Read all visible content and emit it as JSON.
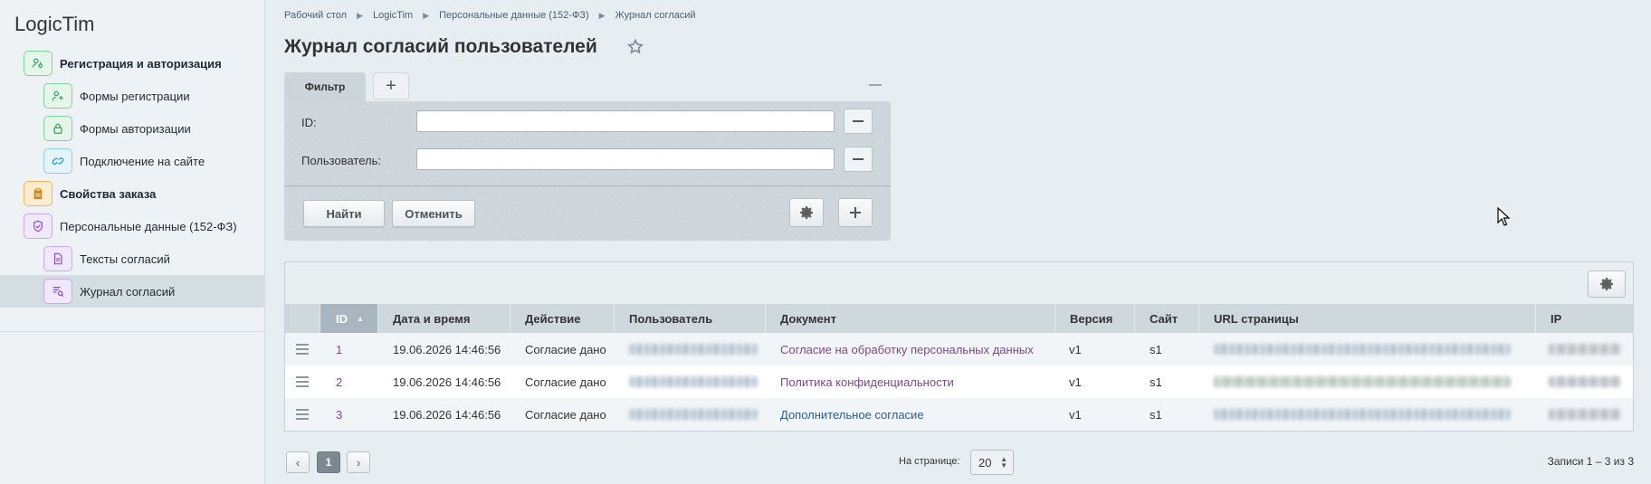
{
  "app": {
    "title": "LogicTim"
  },
  "sidebar": {
    "items": [
      {
        "label": "Регистрация и авторизация",
        "icon": "user-key-icon"
      },
      {
        "label": "Формы регистрации",
        "icon": "user-add-icon"
      },
      {
        "label": "Формы авторизации",
        "icon": "lock-icon"
      },
      {
        "label": "Подключение на сайте",
        "icon": "link-icon"
      },
      {
        "label": "Свойства заказа",
        "icon": "clipboard-icon"
      },
      {
        "label": "Персональные данные (152-ФЗ)",
        "icon": "shield-icon"
      },
      {
        "label": "Тексты согласий",
        "icon": "document-icon"
      },
      {
        "label": "Журнал согласий",
        "icon": "journal-search-icon"
      }
    ],
    "active_item": "Журнал согласий"
  },
  "breadcrumb": [
    "Рабочий стол",
    "LogicTim",
    "Персональные данные (152-ФЗ)",
    "Журнал согласий"
  ],
  "page": {
    "title": "Журнал согласий пользователей"
  },
  "filter": {
    "tab_label": "Фильтр",
    "add_tab_label": "+",
    "fields": [
      {
        "label": "ID:",
        "value": ""
      },
      {
        "label": "Пользователь:",
        "value": ""
      }
    ],
    "find_label": "Найти",
    "cancel_label": "Отменить"
  },
  "grid": {
    "columns": [
      "ID",
      "Дата и время",
      "Действие",
      "Пользователь",
      "Документ",
      "Версия",
      "Сайт",
      "URL страницы",
      "IP"
    ],
    "sorted_column": "ID",
    "sort_direction": "asc",
    "rows": [
      {
        "id": "1",
        "datetime": "19.06.2026 14:46:56",
        "action": "Согласие дано",
        "document": "Согласие на обработку персональных данных",
        "version": "v1",
        "site": "s1"
      },
      {
        "id": "2",
        "datetime": "19.06.2026 14:46:56",
        "action": "Согласие дано",
        "document": "Политика конфиденциальности",
        "version": "v1",
        "site": "s1"
      },
      {
        "id": "3",
        "datetime": "19.06.2026 14:46:56",
        "action": "Согласие дано",
        "document": "Дополнительное согласие",
        "version": "v1",
        "site": "s1"
      }
    ]
  },
  "pager": {
    "prev_label": "‹",
    "current_page": "1",
    "next_label": "›",
    "per_page_label": "На странице:",
    "per_page_value": "20",
    "records_label": "Записи 1 – 3 из 3"
  },
  "colors": {
    "link_purple": "#7a4a85",
    "link_blue": "#2d5d8a",
    "sidebar_active": "#d4dde2"
  }
}
